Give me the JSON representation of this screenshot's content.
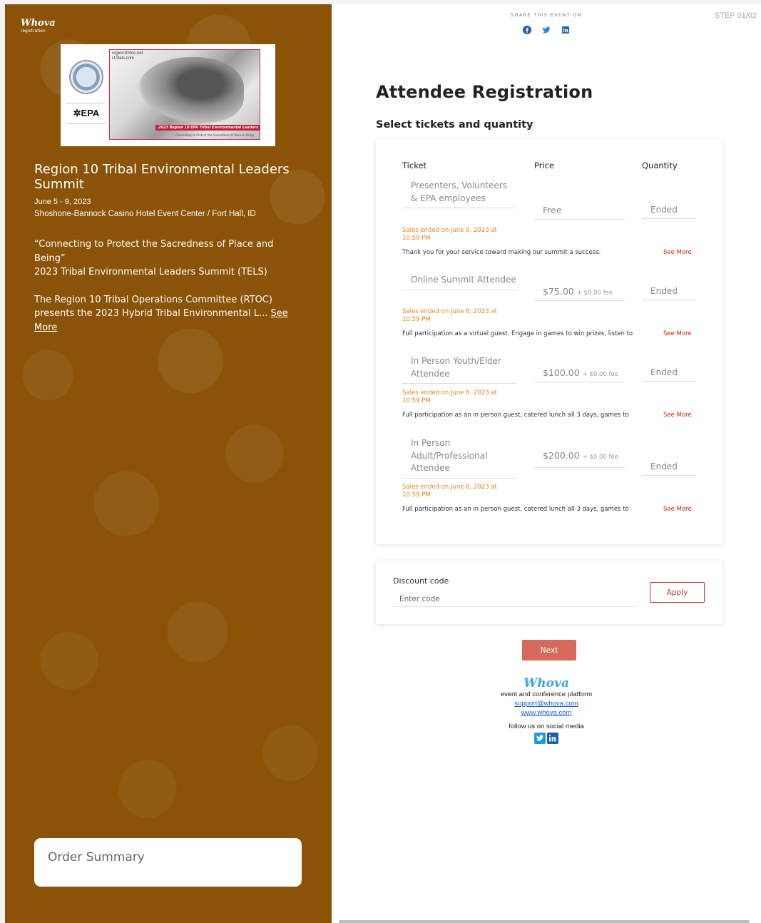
{
  "brand": {
    "name": "Whova",
    "sub": "registration"
  },
  "banner": {
    "url_lines": "region10rtoc.net\nr10tels.com",
    "epa": "✲EPA",
    "red_strip": "2023 Region 10 EPA Tribal Environmental Leaders Summit",
    "tagline": "Connecting to Protect the Sacredness of Place & Being"
  },
  "event": {
    "title": "Region 10 Tribal Environmental Leaders Summit",
    "date": "June 5 - 9, 2023",
    "venue": "Shoshone-Bannock Casino Hotel Event Center / Fort Hall, ID",
    "quote": "“Connecting to Protect the Sacredness of Place and Being”",
    "subtitle": "2023 Tribal Environmental Leaders Summit (TELS)",
    "intro": "The Region 10 Tribal Operations Committee (RTOC) presents the 2023 Hybrid Tribal Environmental L...",
    "see_more": "See More"
  },
  "order_summary": {
    "label": "Order Summary"
  },
  "share": {
    "label": "SHARE THIS EVENT ON"
  },
  "step": "STEP 01/02",
  "page": {
    "title": "Attendee Registration",
    "subtitle": "Select tickets and quantity"
  },
  "table_headers": {
    "ticket": "Ticket",
    "price": "Price",
    "quantity": "Quantity"
  },
  "tickets": [
    {
      "name": "Presenters, Volunteers & EPA employees",
      "price": "Free",
      "fee": "",
      "quantity": "Ended",
      "sales_ended": "Sales ended on June 9, 2023 at 10:59 PM",
      "description": "Thank you for your service toward making our summit a success.",
      "see_more": "See More"
    },
    {
      "name": "Online Summit Attendee",
      "price": "$75.00",
      "fee": "+ $0.00 fee",
      "quantity": "Ended",
      "sales_ended": "Sales ended on June 6, 2023 at 10:59 PM",
      "description": "Full participation as a virtual guest. Engage in games to win prizes, listen to",
      "see_more": "See More"
    },
    {
      "name": "In Person Youth/Elder Attendee",
      "price": "$100.00",
      "fee": "+ $0.00 fee",
      "quantity": "Ended",
      "sales_ended": "Sales ended on June 6, 2023 at 10:59 PM",
      "description": "Full participation as an in person guest, catered lunch all 3 days, games to",
      "see_more": "See More"
    },
    {
      "name": "In Person Adult/Professional Attendee",
      "price": "$200.00",
      "fee": "+ $0.00 fee",
      "quantity": "Ended",
      "sales_ended": "Sales ended on June 6, 2023 at 10:59 PM",
      "description": "Full participation as an in person guest, catered lunch all 3 days, games to",
      "see_more": "See More"
    }
  ],
  "discount": {
    "label": "Discount code",
    "placeholder": "Enter code",
    "apply": "Apply"
  },
  "next": "Next",
  "footer": {
    "logo": "Whova",
    "tagline": "event and conference platform",
    "email": "support@whova.com",
    "website": "www.whova.com",
    "follow": "follow us on social media"
  },
  "colors": {
    "left_panel": "#8a5307",
    "accent_red": "#c0392b",
    "next_button": "#d5695b",
    "sales_ended": "#e8821a",
    "whova_blue": "#3ba6e0"
  },
  "icons": [
    "facebook-icon",
    "twitter-icon",
    "linkedin-icon"
  ]
}
